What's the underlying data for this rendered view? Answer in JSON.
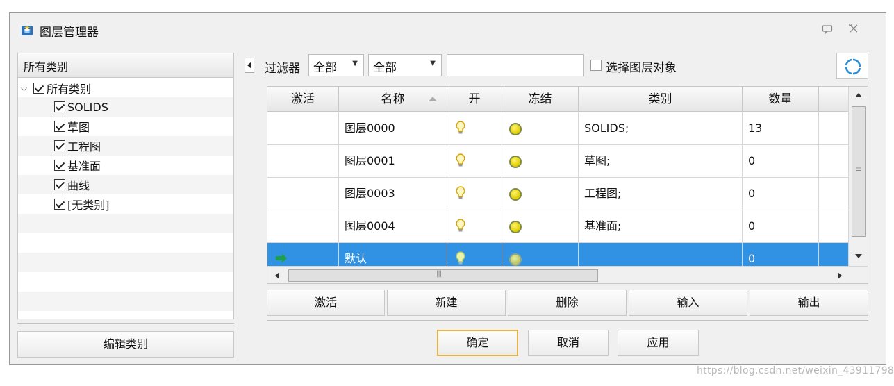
{
  "window": {
    "title": "图层管理器"
  },
  "left_panel": {
    "header": "所有类别",
    "tree": [
      {
        "label": "所有类别",
        "checked": true,
        "expanded": true
      },
      {
        "label": "SOLIDS",
        "checked": true
      },
      {
        "label": "草图",
        "checked": true
      },
      {
        "label": "工程图",
        "checked": true
      },
      {
        "label": "基准面",
        "checked": true
      },
      {
        "label": "曲线",
        "checked": true
      },
      {
        "label": "[无类别]",
        "checked": true
      }
    ],
    "edit_button": "编辑类别"
  },
  "toolbar": {
    "filter_label": "过滤器",
    "filter1_value": "全部",
    "filter2_value": "全部",
    "search_value": "",
    "select_objects_label": "选择图层对象",
    "select_objects_checked": false
  },
  "grid": {
    "columns": [
      "激活",
      "名称",
      "开",
      "冻结",
      "类别",
      "数量"
    ],
    "sort_column": "名称",
    "rows": [
      {
        "active": "",
        "name": "图层0000",
        "category": "SOLIDS;",
        "count": "13",
        "selected": false
      },
      {
        "active": "",
        "name": "图层0001",
        "category": "草图;",
        "count": "0",
        "selected": false
      },
      {
        "active": "",
        "name": "图层0003",
        "category": "工程图;",
        "count": "0",
        "selected": false
      },
      {
        "active": "",
        "name": "图层0004",
        "category": "基准面;",
        "count": "0",
        "selected": false
      },
      {
        "active": "current-arrow",
        "name": "默认",
        "category": "",
        "count": "0",
        "selected": true
      }
    ]
  },
  "actions": {
    "activate": "激活",
    "new": "新建",
    "delete": "删除",
    "import": "输入",
    "export": "输出"
  },
  "footer": {
    "ok": "确定",
    "cancel": "取消",
    "apply": "应用"
  },
  "watermark": "https://blog.csdn.net/weixin_43911798",
  "colors": {
    "selection": "#3191e3",
    "bulb": "#e8c600",
    "freeze": "#f0e000",
    "active_arrow": "#1ea04a",
    "ok_border": "#e3b34a"
  }
}
